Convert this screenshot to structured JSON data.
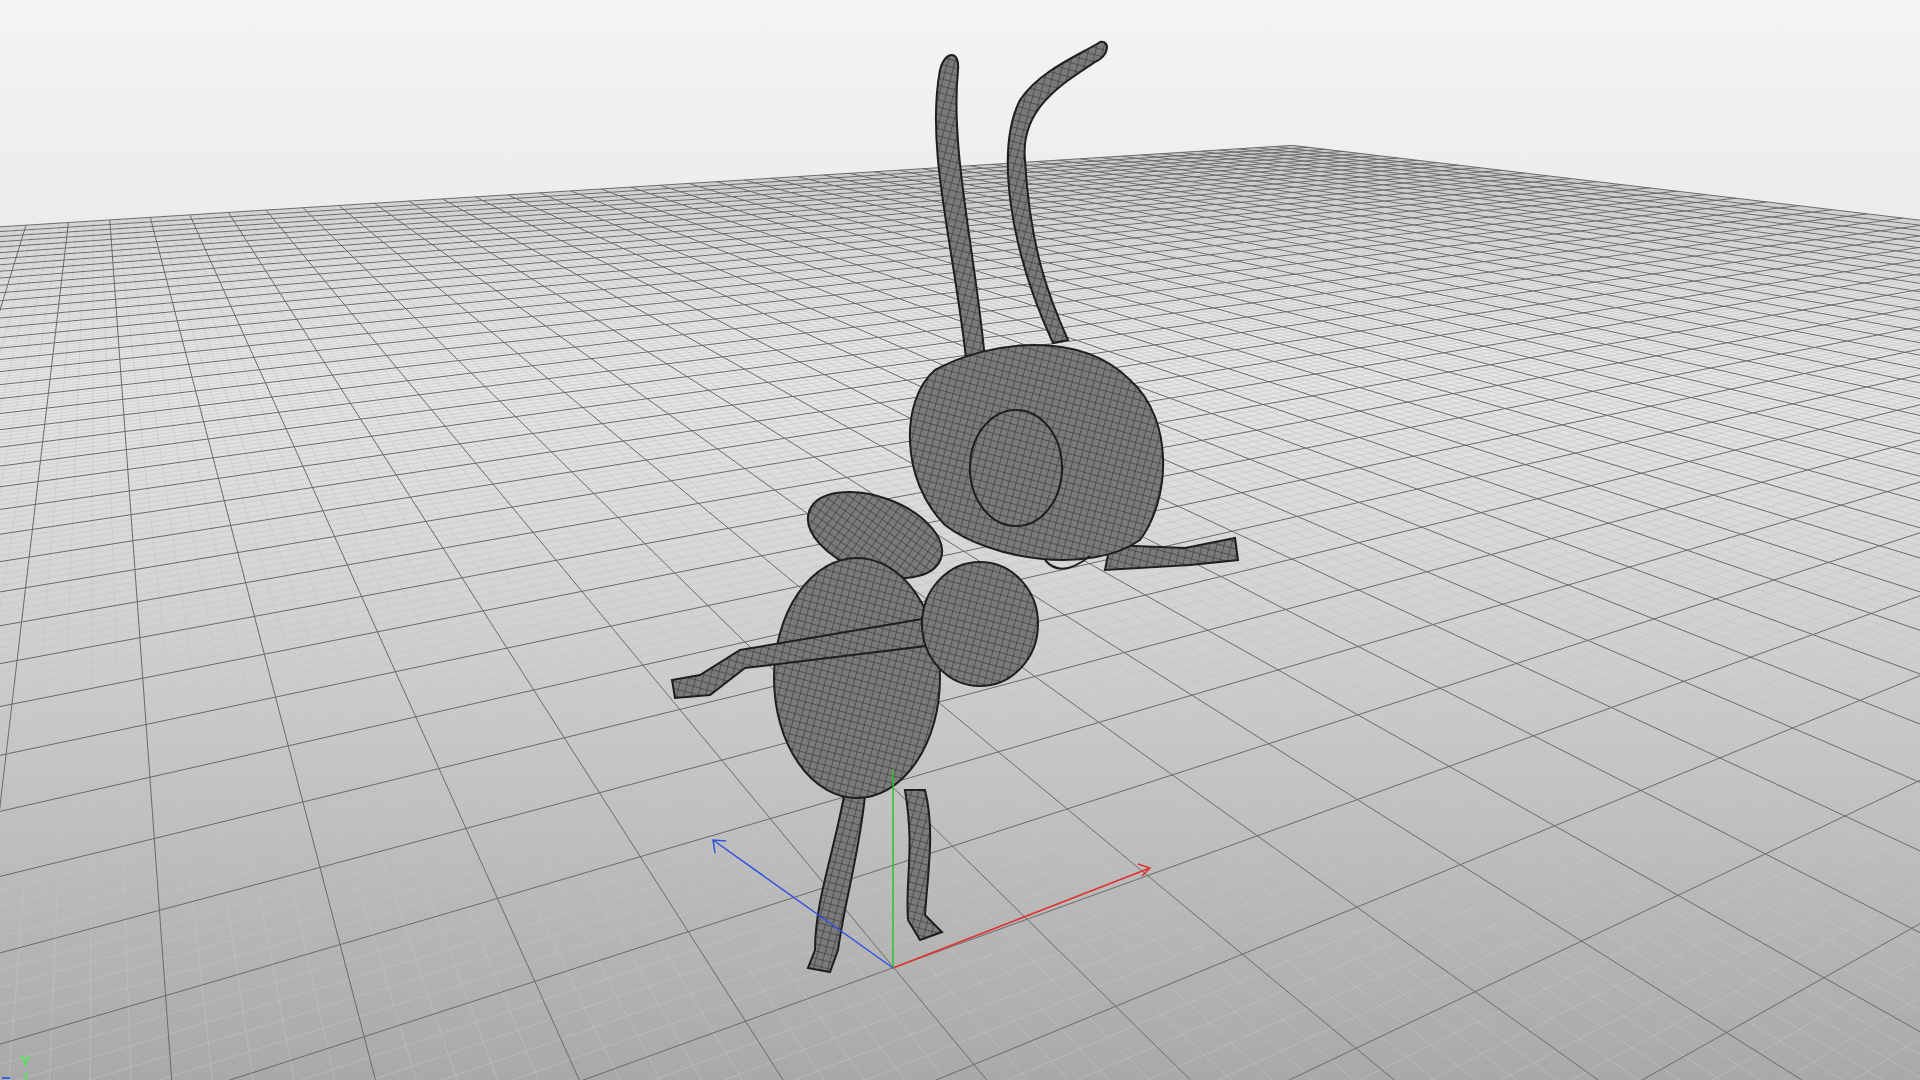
{
  "viewport": {
    "axis_indicator": {
      "y_label": "Y"
    }
  }
}
